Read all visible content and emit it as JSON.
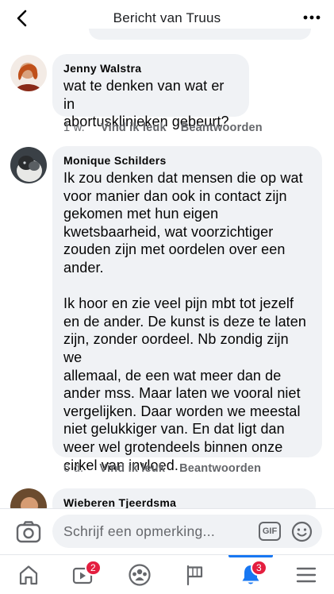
{
  "header": {
    "title": "Bericht van Truus"
  },
  "comments": [
    {
      "author": "Jenny Walstra",
      "text": "wat te denken van wat er in\nabortusklinieken gebeurt?",
      "time": "1 w.",
      "like_label": "Vind ik leuk",
      "reply_label": "Beantwoorden"
    },
    {
      "author": "Monique Schilders",
      "text": "Ik zou denken dat mensen die op wat\nvoor manier dan ook in contact zijn\ngekomen met hun eigen\nkwetsbaarheid, wat voorzichtiger\nzouden zijn met oordelen over een\nander.\n\nIk hoor en zie veel pijn mbt tot jezelf\nen de ander. De kunst is deze te laten\nzijn, zonder oordeel. Nb zondig zijn we\nallemaal, de een wat meer dan de\nander mss. Maar laten we vooral niet\nvergelijken. Daar worden we meestal\nniet gelukkiger van. En dat ligt dan\nweer wel grotendeels binnen onze\ncirkel van invloed.",
      "time": "6 d.",
      "like_label": "Vind ik leuk",
      "reply_label": "Beantwoorden"
    },
    {
      "author": "Wieberen Tjeerdsma"
    }
  ],
  "composer": {
    "placeholder": "Schrijf een opmerking...",
    "gif_label": "GIF"
  },
  "nav": {
    "items": [
      {
        "icon": "home-icon"
      },
      {
        "icon": "video-icon",
        "badge": "2"
      },
      {
        "icon": "groups-icon"
      },
      {
        "icon": "flag-icon"
      },
      {
        "icon": "bell-icon",
        "badge": "3",
        "active": true
      },
      {
        "icon": "menu-icon"
      }
    ]
  },
  "colors": {
    "bubble": "#f0f2f5",
    "meta_text": "#65676b",
    "accent": "#1877f2",
    "badge": "#e41e3f"
  }
}
